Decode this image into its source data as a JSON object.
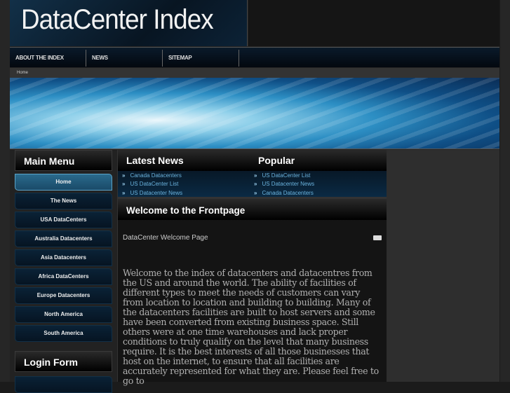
{
  "site": {
    "title": "DataCenter Index"
  },
  "nav": [
    "ABOUT THE INDEX",
    "NEWS",
    "SITEMAP"
  ],
  "breadcrumb": "Home",
  "main_menu": {
    "title": "Main Menu",
    "items": [
      "Home",
      "The News",
      "USA DataCenters",
      "Australia Datacenters",
      "Asia Datacenters",
      "Africa DataCenters",
      "Europe Datacenters",
      "North America",
      "South America"
    ]
  },
  "login": {
    "title": "Login Form"
  },
  "latest_news": {
    "title": "Latest News",
    "items": [
      "Canada Datacenters",
      "US DataCenter List",
      "US Datacenter News"
    ]
  },
  "popular": {
    "title": "Popular",
    "items": [
      "US DataCenter List",
      "US Datacenter News",
      "Canada Datacenters"
    ]
  },
  "article": {
    "heading": "Welcome to the Frontpage",
    "subtitle": "DataCenter Welcome Page",
    "body": "Welcome to the index of datacenters and datacentres from the US and around the world.  The ability of facilities of different types to meet the needs of customers can vary from location to location and building to building.  Many of the datacenters facilities are built to host servers and some have been converted from existing business space.  Still others were at one time warehouses and lack proper conditions to truly qualify on the level that many business require.  It is the best interests of all those businesses that host on the internet, to ensure that all facilities are accurately represented for what they are.  Please feel free to go to"
  }
}
